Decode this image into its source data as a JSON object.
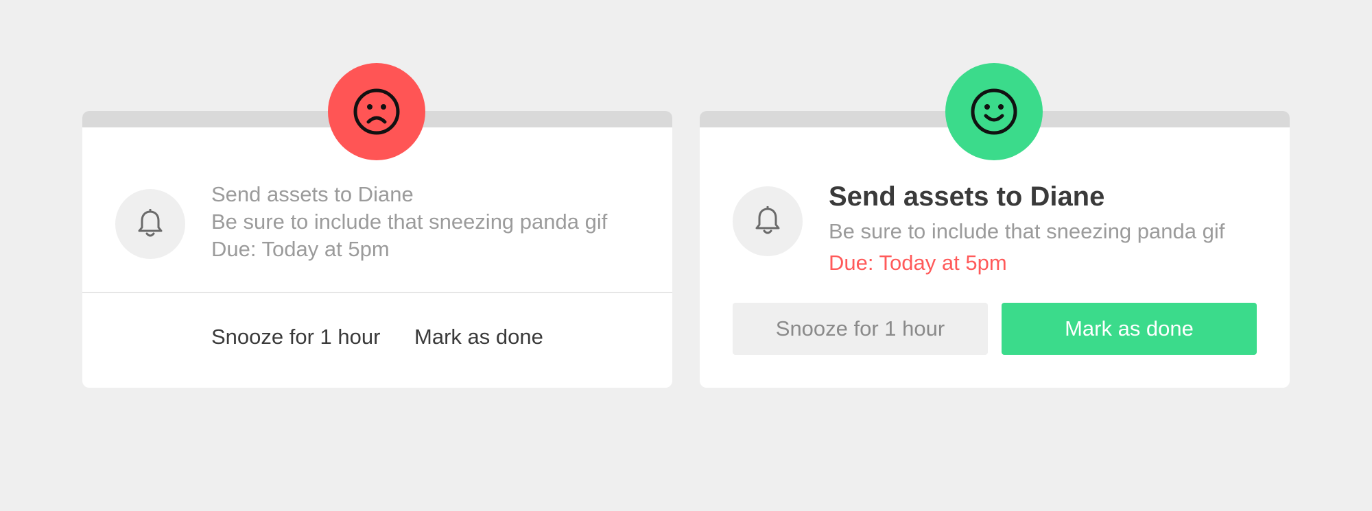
{
  "colors": {
    "background": "#efefef",
    "card": "#ffffff",
    "topbar": "#d9d9d9",
    "bad": "#ff5555",
    "good": "#3bdb8b",
    "muted_text": "#9b9b9b",
    "dark_text": "#3a3a3a",
    "due_alert": "#ff5a5a"
  },
  "bad_example": {
    "mood_icon": "frown-face-icon",
    "reminder_icon": "bell-icon",
    "title": "Send assets to Diane",
    "description": "Be sure to include that sneezing panda gif",
    "due": "Due: Today at 5pm",
    "snooze_label": "Snooze for 1 hour",
    "done_label": "Mark as done"
  },
  "good_example": {
    "mood_icon": "smile-face-icon",
    "reminder_icon": "bell-icon",
    "title": "Send assets to Diane",
    "description": "Be sure to include that sneezing panda gif",
    "due": "Due: Today at 5pm",
    "snooze_label": "Snooze for 1 hour",
    "done_label": "Mark as done"
  }
}
